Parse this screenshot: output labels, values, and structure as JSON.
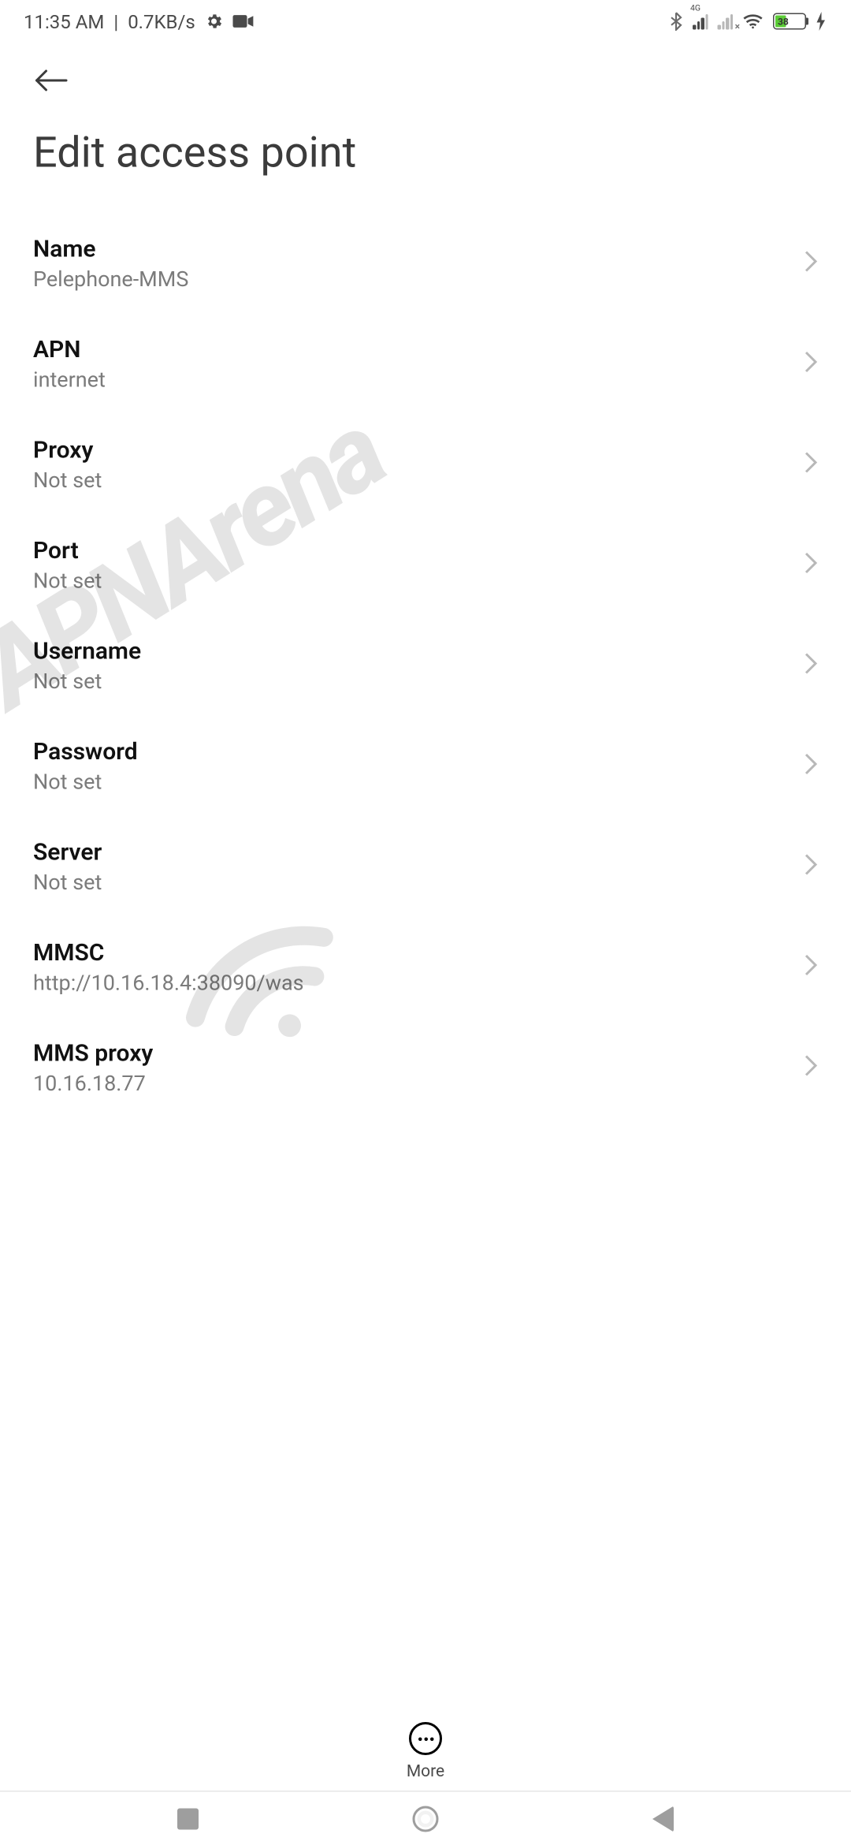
{
  "status": {
    "time": "11:35 AM",
    "separator": "|",
    "data_rate": "0.7KB/s",
    "network_label": "4G",
    "battery_percent": "38"
  },
  "header": {
    "title": "Edit access point"
  },
  "settings": [
    {
      "label": "Name",
      "value": "Pelephone-MMS"
    },
    {
      "label": "APN",
      "value": "internet"
    },
    {
      "label": "Proxy",
      "value": "Not set"
    },
    {
      "label": "Port",
      "value": "Not set"
    },
    {
      "label": "Username",
      "value": "Not set"
    },
    {
      "label": "Password",
      "value": "Not set"
    },
    {
      "label": "Server",
      "value": "Not set"
    },
    {
      "label": "MMSC",
      "value": "http://10.16.18.4:38090/was"
    },
    {
      "label": "MMS proxy",
      "value": "10.16.18.77"
    }
  ],
  "bottom": {
    "more_label": "More"
  },
  "watermark": {
    "text": "APNArena"
  }
}
